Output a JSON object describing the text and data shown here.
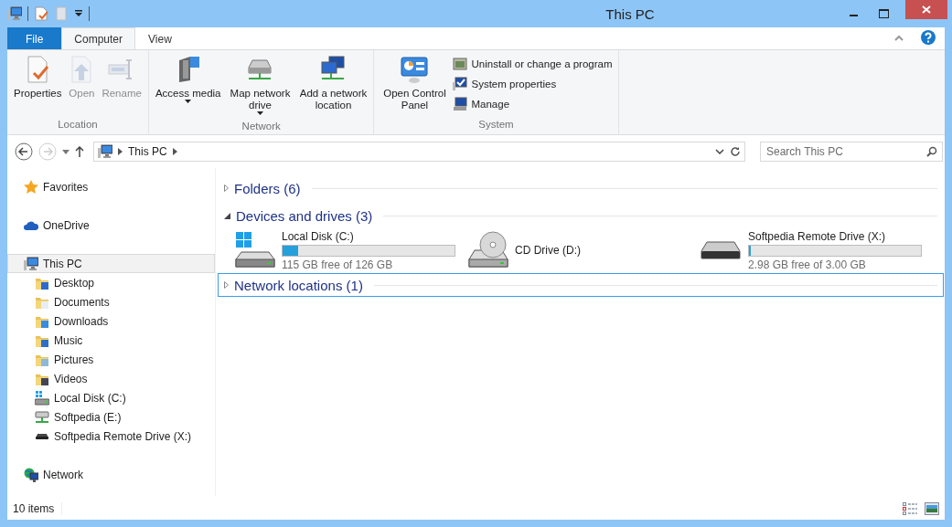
{
  "window": {
    "title": "This PC"
  },
  "ribbon": {
    "tabs": [
      {
        "label": "File",
        "kind": "file",
        "selected": false
      },
      {
        "label": "Computer",
        "kind": "tab",
        "selected": true
      },
      {
        "label": "View",
        "kind": "tab",
        "selected": false
      }
    ],
    "groups": [
      {
        "label": "Location",
        "items": [
          {
            "kind": "large",
            "label": "Properties",
            "disabled": false,
            "dropdown": false
          },
          {
            "kind": "large",
            "label": "Open",
            "disabled": true,
            "dropdown": false
          },
          {
            "kind": "large",
            "label": "Rename",
            "disabled": true,
            "dropdown": false
          }
        ]
      },
      {
        "label": "Network",
        "items": [
          {
            "kind": "large",
            "label": "Access media",
            "disabled": false,
            "dropdown": true
          },
          {
            "kind": "large",
            "label": "Map network drive",
            "disabled": false,
            "dropdown": true
          },
          {
            "kind": "large",
            "label": "Add a network location",
            "disabled": false,
            "dropdown": false
          }
        ]
      },
      {
        "label": "System",
        "items": [
          {
            "kind": "large",
            "label": "Open Control Panel",
            "disabled": false,
            "dropdown": false
          },
          {
            "kind": "small",
            "label": "Uninstall or change a program",
            "disabled": false,
            "dropdown": false
          },
          {
            "kind": "small",
            "label": "System properties",
            "disabled": false,
            "dropdown": false
          },
          {
            "kind": "small",
            "label": "Manage",
            "disabled": false,
            "dropdown": false
          }
        ]
      }
    ]
  },
  "address": {
    "path": [
      "This PC"
    ],
    "search_placeholder": "Search This PC",
    "back_disabled": false,
    "forward_disabled": true
  },
  "sidebar": {
    "items": [
      {
        "label": "Favorites",
        "selected": false
      },
      {
        "label": "OneDrive",
        "selected": false
      },
      {
        "label": "This PC",
        "selected": true,
        "children": [
          {
            "label": "Desktop",
            "selected": false
          },
          {
            "label": "Documents",
            "selected": false
          },
          {
            "label": "Downloads",
            "selected": false
          },
          {
            "label": "Music",
            "selected": false
          },
          {
            "label": "Pictures",
            "selected": false
          },
          {
            "label": "Videos",
            "selected": false
          },
          {
            "label": "Local Disk (C:)",
            "selected": false
          },
          {
            "label": "Softpedia (E:)",
            "selected": false
          },
          {
            "label": "Softpedia Remote Drive (X:)",
            "selected": false
          }
        ]
      },
      {
        "label": "Network",
        "selected": false
      }
    ]
  },
  "sections": [
    {
      "title": "Folders (6)",
      "expanded": false,
      "focused": false
    },
    {
      "title": "Devices and drives (3)",
      "expanded": true,
      "focused": false,
      "drives": [
        {
          "kind": "disk",
          "name": "Local Disk (C:)",
          "level": 0.09,
          "free": "115 GB free of 126 GB"
        },
        {
          "kind": "cd",
          "name": "CD Drive (D:)"
        },
        {
          "kind": "disk",
          "name": "Softpedia Remote Drive (X:)",
          "level": 0.01,
          "free": "2.98 GB free of 3.00 GB"
        }
      ]
    },
    {
      "title": "Network locations (1)",
      "expanded": false,
      "focused": true
    }
  ],
  "status_bar": {
    "text": "10 items"
  }
}
